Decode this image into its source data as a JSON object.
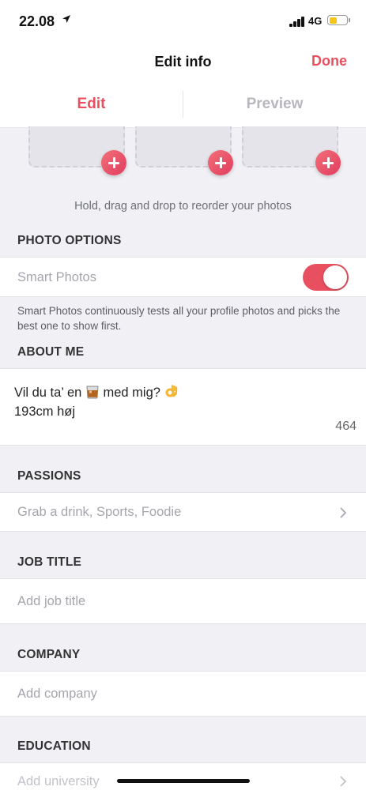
{
  "status_bar": {
    "time": "22.08",
    "network": "4G",
    "battery_level": 0.46
  },
  "nav": {
    "title": "Edit info",
    "done_label": "Done"
  },
  "tabs": [
    {
      "label": "Edit",
      "active": true
    },
    {
      "label": "Preview",
      "active": false
    }
  ],
  "photos": {
    "reorder_hint": "Hold, drag and drop to reorder your photos"
  },
  "photo_options": {
    "header": "PHOTO OPTIONS",
    "smart_photos_label": "Smart Photos",
    "smart_photos_enabled": true,
    "description": "Smart Photos continuously tests all your profile photos and picks the best one to show first."
  },
  "about": {
    "header": "ABOUT ME",
    "line1_prefix": "Vil du ta’ en",
    "line1_suffix": "med mig?",
    "line2": "193cm høj",
    "char_count": "464"
  },
  "passions": {
    "header": "PASSIONS",
    "value": "Grab a drink, Sports, Foodie"
  },
  "job": {
    "header": "JOB TITLE",
    "placeholder": "Add job title"
  },
  "company": {
    "header": "COMPANY",
    "placeholder": "Add company"
  },
  "education": {
    "header": "EDUCATION",
    "placeholder": "Add university"
  },
  "colors": {
    "accent": "#e9505f",
    "background": "#f0f0f5",
    "toggle_on": "#e9505f"
  }
}
